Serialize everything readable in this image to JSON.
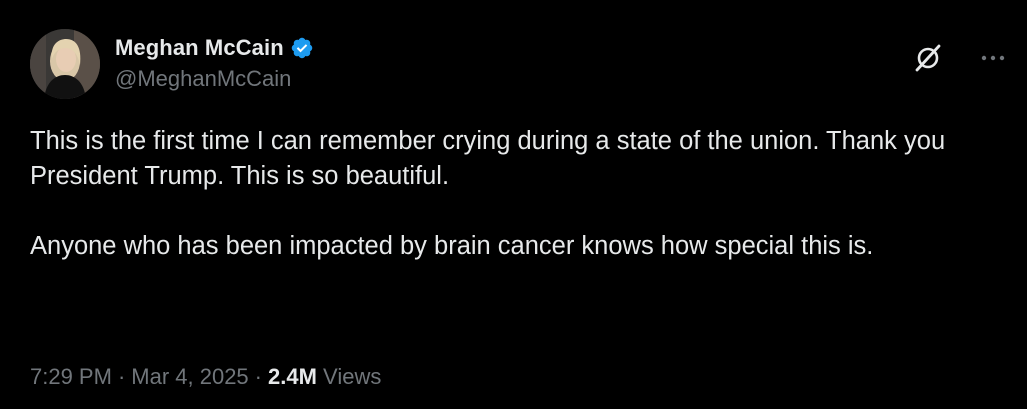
{
  "author": {
    "display_name": "Meghan McCain",
    "handle": "@MeghanMcCain",
    "verified": true,
    "verified_color": "#1d9bf0"
  },
  "tweet": {
    "paragraphs": [
      "This is the first time I can remember crying during a state of the union. Thank you President Trump. This is so beautiful.",
      "Anyone who has been impacted by brain cancer knows how special this is."
    ],
    "time": "7:29 PM",
    "date": "Mar 4, 2025",
    "separator": "·",
    "views_count": "2.4M",
    "views_label": "Views"
  },
  "icons": {
    "verified": "verified-badge-icon",
    "grok": "grok-icon",
    "more": "more-options-icon"
  },
  "colors": {
    "background": "#000000",
    "primary_text": "#e7e9ea",
    "secondary_text": "#71767b",
    "accent": "#1d9bf0"
  }
}
